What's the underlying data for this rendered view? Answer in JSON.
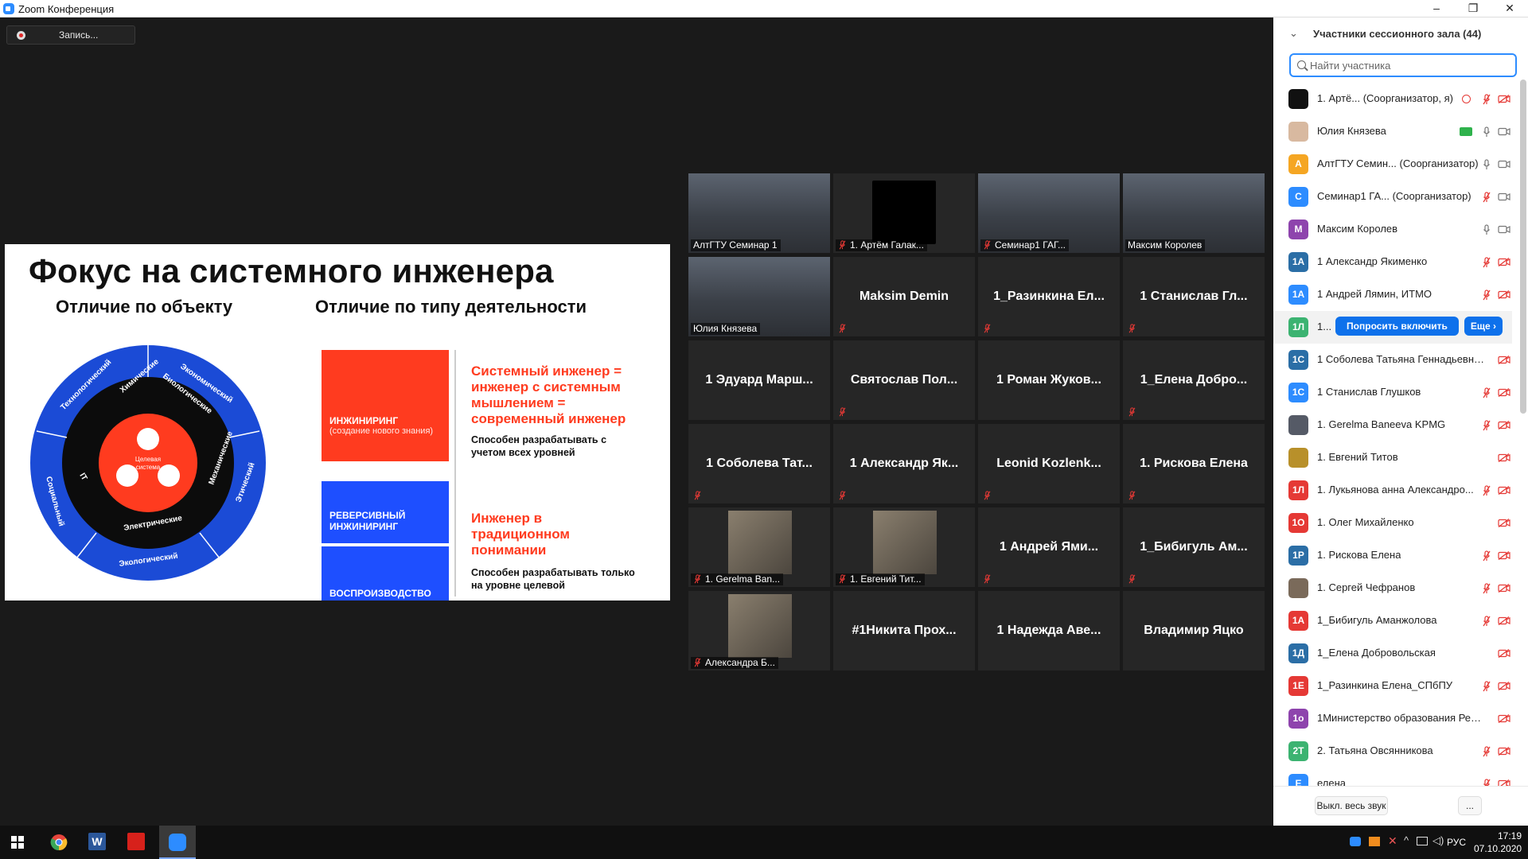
{
  "window": {
    "title": "Zoom Конференция",
    "controls": [
      "–",
      "❐",
      "✕"
    ]
  },
  "record_button": {
    "label": "Запись..."
  },
  "slide": {
    "title": "Фокус на системного инженера",
    "subtitle_left": "Отличие по объекту",
    "subtitle_right": "Отличие по типу деятельности",
    "wheel": {
      "center": [
        "Целевая",
        "система"
      ],
      "middle": [
        "Химические",
        "Биологические",
        "Механические",
        "Электрические",
        "IT"
      ],
      "outer": [
        "Технологический",
        "Экономический",
        "Этический",
        "Экологический",
        "Социальный"
      ]
    },
    "boxes": [
      {
        "label": "ИНЖИНИРИНГ",
        "note": "(создание нового знания)",
        "color": "#ff3b1f"
      },
      {
        "label": "РЕВЕРСИВНЫЙ ИНЖИНИРИНГ",
        "note": "",
        "color": "#1e4fff"
      },
      {
        "label": "ВОСПРОИЗВОДСТВО",
        "note": "",
        "color": "#1e4fff"
      }
    ],
    "text_blocks": [
      {
        "red": "Системный инженер = инженер с системным мышлением = современный инженер",
        "black": "Способен разрабатывать с учетом всех уровней"
      },
      {
        "red": "Инженер в традиционном понимании",
        "black": "Способен разрабатывать только на уровне целевой"
      }
    ]
  },
  "video_tiles": [
    {
      "caption": "АлтГТУ Семинар 1",
      "kind": "video",
      "muted": false
    },
    {
      "caption": "1. Артём Галак...",
      "kind": "logo",
      "muted": true
    },
    {
      "caption": "Семинар1 ГАГ...",
      "kind": "video",
      "muted": true
    },
    {
      "caption": "Максим Королев",
      "kind": "video",
      "muted": false
    },
    {
      "caption": "Юлия Князева",
      "kind": "video",
      "muted": false,
      "active": true
    },
    {
      "name": "Maksim Demin",
      "muted": true
    },
    {
      "name": "1_Разинкина Ел...",
      "muted": true
    },
    {
      "name": "1 Станислав Гл...",
      "muted": true
    },
    {
      "name": "1 Эдуард Марш...",
      "muted": false
    },
    {
      "name": "Святослав Пол...",
      "muted": true
    },
    {
      "name": "1 Роман Жуков...",
      "muted": false
    },
    {
      "name": "1_Елена Добро...",
      "muted": true
    },
    {
      "name": "1 Соболева Тат...",
      "muted": true
    },
    {
      "name": "1 Александр Як...",
      "muted": true
    },
    {
      "name": "Leonid Kozlenk...",
      "muted": true
    },
    {
      "name": "1. Рискова Елена",
      "muted": true
    },
    {
      "caption": "1. Gerelma Ban...",
      "kind": "photo",
      "muted": true
    },
    {
      "caption": "1. Евгений Тит...",
      "kind": "photo",
      "muted": true
    },
    {
      "name": "1 Андрей Ями...",
      "muted": true
    },
    {
      "name": "1_Бибигуль Ам...",
      "muted": true
    },
    {
      "caption": "Александра Б...",
      "kind": "photo",
      "muted": true
    },
    {
      "name": "#1Никита Прох...",
      "muted": false
    },
    {
      "name": "1 Надежда Аве...",
      "muted": false
    },
    {
      "name": "Владимир Яцко",
      "muted": false
    }
  ],
  "participants_panel": {
    "header": "Участники сессионного зала (44)",
    "search_placeholder": "Найти участника",
    "rows": [
      {
        "avatar": "",
        "avatar_color": "#111111",
        "name": "1. Артё... (Соорганизатор, я)",
        "mic": "muted",
        "cam": "off",
        "rec": true
      },
      {
        "avatar": "",
        "avatar_color": "#d8b9a0",
        "name": "Юлия Князева",
        "mic": "on",
        "cam": "on",
        "share": true
      },
      {
        "avatar": "А",
        "avatar_color": "#f5a623",
        "name": "АлтГТУ Семин... (Соорганизатор)",
        "mic": "on",
        "cam": "on"
      },
      {
        "avatar": "С",
        "avatar_color": "#2d8cff",
        "name": "Семинар1 ГА... (Соорганизатор)",
        "mic": "muted",
        "cam": "on"
      },
      {
        "avatar": "М",
        "avatar_color": "#8e44ad",
        "name": "Максим Королев",
        "mic": "on",
        "cam": "on"
      },
      {
        "avatar": "1А",
        "avatar_color": "#2b6ea6",
        "name": "1 Александр Якименко",
        "mic": "muted",
        "cam": "off"
      },
      {
        "avatar": "1А",
        "avatar_color": "#2d8cff",
        "name": "1 Андрей Лямин, ИТМО",
        "mic": "muted",
        "cam": "off"
      },
      {
        "avatar": "1Л",
        "avatar_color": "#3cb371",
        "name": "1...",
        "ask_button": "Попросить включить",
        "more_button": "Еще ›"
      },
      {
        "avatar": "1С",
        "avatar_color": "#2b6ea6",
        "name": "1 Соболева Татьяна Геннадьевна, ...",
        "mic": "",
        "cam": "off"
      },
      {
        "avatar": "1С",
        "avatar_color": "#2d8cff",
        "name": "1 Станислав Глушков",
        "mic": "muted",
        "cam": "off"
      },
      {
        "avatar": "",
        "avatar_color": "#555a66",
        "name": "1. Gerelma Baneeva KPMG",
        "mic": "muted",
        "cam": "off"
      },
      {
        "avatar": "",
        "avatar_color": "#b8902a",
        "name": "1. Евгений Титов",
        "mic": "",
        "cam": "off"
      },
      {
        "avatar": "1Л",
        "avatar_color": "#e53935",
        "name": "1. Лукьянова анна Александро...",
        "mic": "muted",
        "cam": "off"
      },
      {
        "avatar": "1О",
        "avatar_color": "#e53935",
        "name": "1. Олег Михайленко",
        "mic": "",
        "cam": "off"
      },
      {
        "avatar": "1Р",
        "avatar_color": "#2b6ea6",
        "name": "1. Рискова Елена",
        "mic": "muted",
        "cam": "off"
      },
      {
        "avatar": "",
        "avatar_color": "#7a6a5a",
        "name": "1. Сергей Чефранов",
        "mic": "muted",
        "cam": "off"
      },
      {
        "avatar": "1А",
        "avatar_color": "#e53935",
        "name": "1_Бибигуль Аманжолова",
        "mic": "muted",
        "cam": "off"
      },
      {
        "avatar": "1Д",
        "avatar_color": "#2b6ea6",
        "name": "1_Елена Добровольская",
        "mic": "",
        "cam": "off"
      },
      {
        "avatar": "1Е",
        "avatar_color": "#e53935",
        "name": "1_Разинкина Елена_СПбПУ",
        "mic": "muted",
        "cam": "off"
      },
      {
        "avatar": "1о",
        "avatar_color": "#8e44ad",
        "name": "1Министерство образования Респ...",
        "mic": "",
        "cam": "off"
      },
      {
        "avatar": "2Т",
        "avatar_color": "#3cb371",
        "name": "2. Татьяна Овсянникова",
        "mic": "muted",
        "cam": "off"
      },
      {
        "avatar": "Е",
        "avatar_color": "#2d8cff",
        "name": "елена",
        "mic": "muted",
        "cam": "off"
      }
    ],
    "mute_all_label": "Выкл. весь звук",
    "more_label": "..."
  },
  "taskbar": {
    "apps": [
      "windows-start",
      "chrome",
      "word",
      "acrobat",
      "zoom"
    ],
    "lang": "РУС",
    "time": "17:19",
    "date": "07.10.2020"
  }
}
